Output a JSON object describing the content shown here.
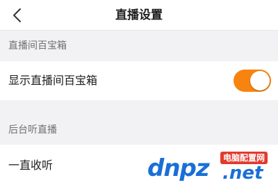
{
  "nav": {
    "title": "直播设置",
    "back_icon": "chevron-left-icon"
  },
  "sections": [
    {
      "header": "直播间百宝箱",
      "rows": [
        {
          "label": "显示直播间百宝箱",
          "toggle_on": true
        }
      ]
    },
    {
      "header": "后台听直播",
      "rows": [
        {
          "label": "一直收听"
        }
      ]
    }
  ],
  "colors": {
    "accent": "#f7840f",
    "watermark_blue": "#1a6fd6",
    "watermark_red": "#e23a2e"
  },
  "watermark": {
    "logo": "dnpz",
    "suffix": ".net",
    "badge": "电脑配置网"
  }
}
